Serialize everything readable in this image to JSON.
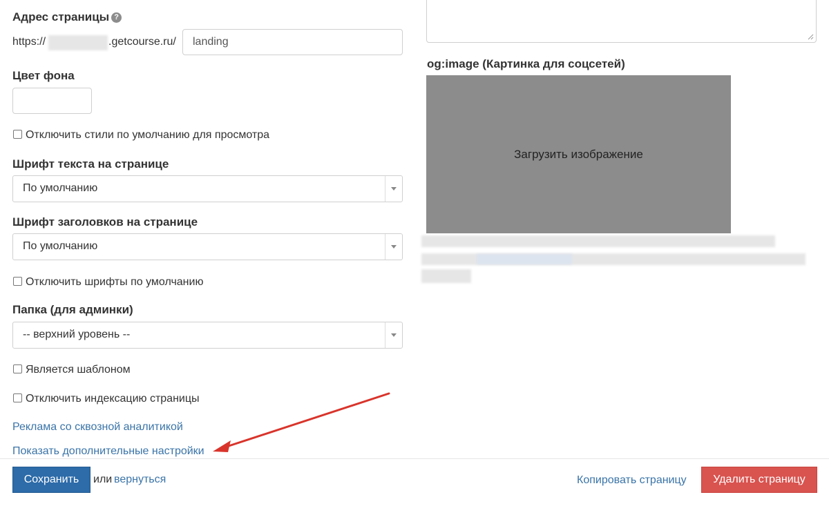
{
  "left": {
    "page_address": {
      "label": "Адрес страницы",
      "help_icon": "?",
      "prefix": "https://",
      "domain": ".getcourse.ru/",
      "value": "landing"
    },
    "bg_color": {
      "label": "Цвет фона",
      "value": ""
    },
    "disable_default_styles": {
      "label": "Отключить стили по умолчанию для просмотра",
      "checked": false
    },
    "text_font": {
      "label": "Шрифт текста на странице",
      "selected": "По умолчанию"
    },
    "heading_font": {
      "label": "Шрифт заголовков на странице",
      "selected": "По умолчанию"
    },
    "disable_default_fonts": {
      "label": "Отключить шрифты по умолчанию",
      "checked": false
    },
    "folder": {
      "label": "Папка (для админки)",
      "selected": "-- верхний уровень --"
    },
    "is_template": {
      "label": "Является шаблоном",
      "checked": false
    },
    "disable_indexing": {
      "label": "Отключить индексацию страницы",
      "checked": false
    },
    "ads_link": "Реклама со сквозной аналитикой",
    "more_settings_link": "Показать дополнительные настройки"
  },
  "right": {
    "og_image_label": "og:image (Картинка для соцсетей)",
    "upload_label": "Загрузить изображение"
  },
  "footer": {
    "save_button": "Сохранить",
    "or_text": "или",
    "back_link": "вернуться",
    "copy_link": "Копировать страницу",
    "delete_button": "Удалить страницу"
  },
  "colors": {
    "primary": "#2d6ba9",
    "danger": "#d9534f",
    "link": "#3a74a8",
    "annotation_arrow": "#d9342b",
    "upload_bg": "#8c8c8c"
  }
}
